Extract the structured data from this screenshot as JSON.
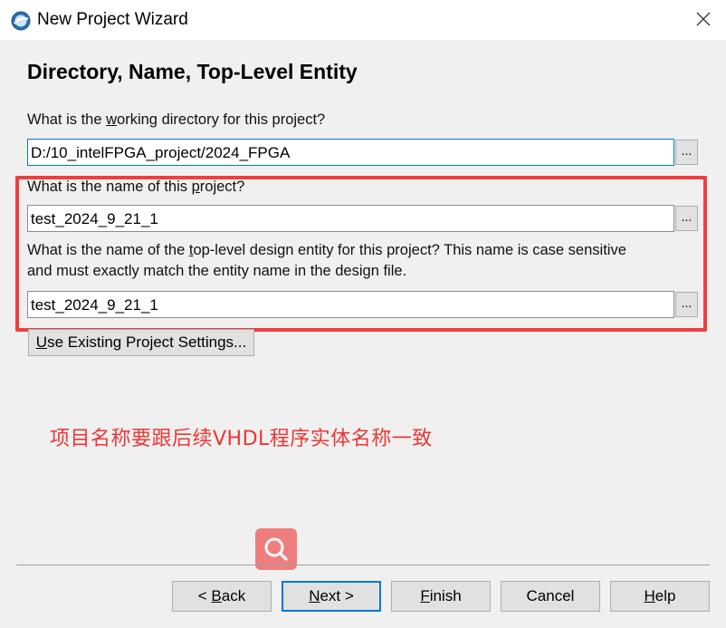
{
  "window": {
    "title": "New Project Wizard",
    "app_icon": "quartus-globe-icon",
    "close_icon": "close-icon"
  },
  "page": {
    "heading": "Directory, Name, Top-Level Entity"
  },
  "working_dir": {
    "label_pre": "What is the ",
    "label_accel": "w",
    "label_post": "orking directory for this project?",
    "value": "D:/10_intelFPGA_project/2024_FPGA",
    "browse_label": "..."
  },
  "project_name": {
    "label_pre": "What is the name of this ",
    "label_accel": "p",
    "label_post": "roject?",
    "value": "test_2024_9_21_1",
    "browse_label": "..."
  },
  "top_entity": {
    "label_line1_pre": "What is the name of the ",
    "label_accel": "t",
    "label_line1_post": "op-level design entity for this project? This name is case sensitive",
    "label_line2": "and must exactly match the entity name in the design file.",
    "value": "test_2024_9_21_1",
    "browse_label": "..."
  },
  "use_existing": {
    "accel": "U",
    "label": "se Existing Project Settings..."
  },
  "annotation": {
    "text": "项目名称要跟后续VHDL程序实体名称一致",
    "color": "#ee3535"
  },
  "floating_search": {
    "icon": "search-icon"
  },
  "footer": {
    "back": {
      "pre": "< ",
      "accel": "B",
      "post": "ack"
    },
    "next": {
      "pre": "",
      "accel": "N",
      "post": "ext >"
    },
    "finish": {
      "pre": "",
      "accel": "F",
      "post": "inish"
    },
    "cancel": {
      "pre": "",
      "accel": "",
      "post": "Cancel"
    },
    "help": {
      "pre": "",
      "accel": "H",
      "post": "elp"
    }
  },
  "colors": {
    "highlight_box": "#ef3e3e",
    "focus_border": "#0078d7"
  }
}
